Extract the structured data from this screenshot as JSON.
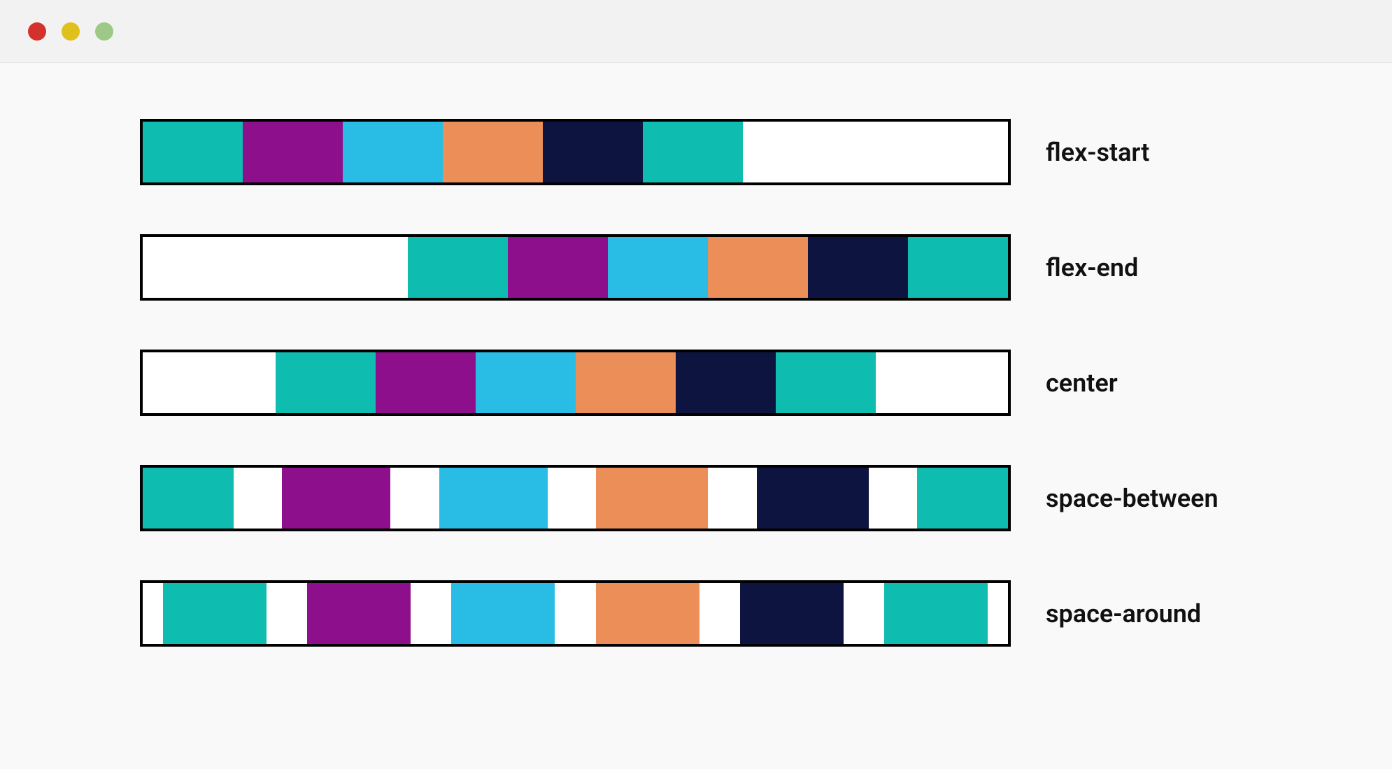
{
  "window": {
    "traffic_lights": {
      "close_color": "#d5312c",
      "minimize_color": "#e0c01a",
      "zoom_color": "#9cc987"
    }
  },
  "item_colors": [
    "#0fbdb0",
    "#8e0f8b",
    "#29bde6",
    "#eb8e58",
    "#0d1440",
    "#0fbdb0"
  ],
  "rows": [
    {
      "name": "flex-start",
      "label": "flex-start",
      "justify": "flex-start",
      "item_widths": [
        143,
        143,
        143,
        143,
        143,
        143
      ]
    },
    {
      "name": "flex-end",
      "label": "flex-end",
      "justify": "flex-end",
      "item_widths": [
        143,
        143,
        143,
        143,
        143,
        143
      ]
    },
    {
      "name": "center",
      "label": "center",
      "justify": "center",
      "item_widths": [
        143,
        143,
        143,
        143,
        143,
        143
      ]
    },
    {
      "name": "space-between",
      "label": "space-between",
      "justify": "space-between",
      "item_widths": [
        130,
        155,
        155,
        160,
        160,
        130
      ]
    },
    {
      "name": "space-around",
      "label": "space-around",
      "justify": "space-around",
      "item_widths": [
        148,
        148,
        148,
        148,
        148,
        148
      ]
    }
  ]
}
